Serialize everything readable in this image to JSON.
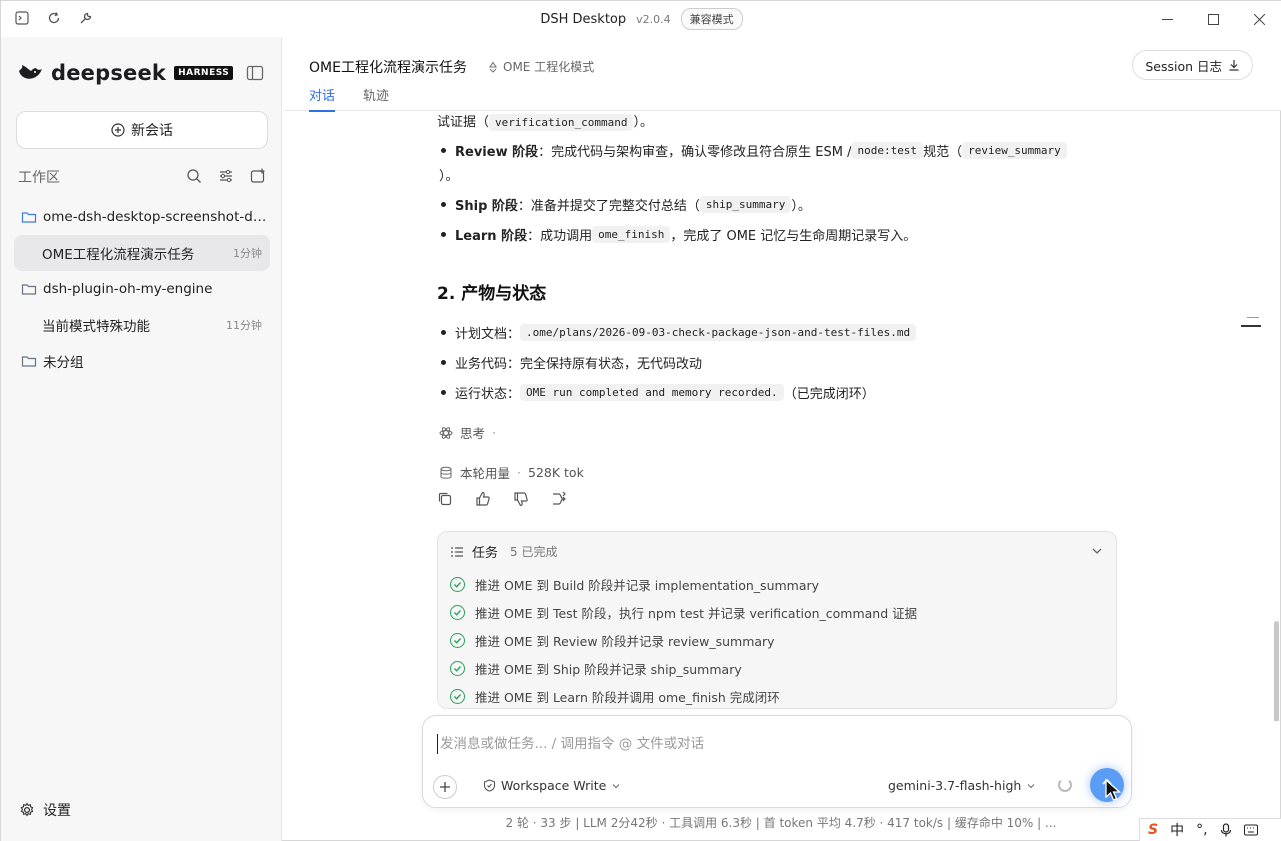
{
  "titlebar": {
    "title": "DSH Desktop",
    "version": "v2.0.4",
    "badge": "兼容模式"
  },
  "sidebar": {
    "brand_name": "deepseek",
    "brand_tag": "HARNESS",
    "new_chat": "新会话",
    "workspace_label": "工作区",
    "tree": [
      {
        "label": "ome-dsh-desktop-screenshot-de...",
        "type": "folder",
        "active": true
      },
      {
        "label": "OME工程化流程演示任务",
        "type": "session",
        "time": "1分钟",
        "selected": true
      },
      {
        "label": "dsh-plugin-oh-my-engine",
        "type": "folder"
      },
      {
        "label": "当前模式特殊功能",
        "type": "session",
        "time": "11分钟"
      },
      {
        "label": "未分组",
        "type": "folder"
      }
    ],
    "settings": "设置"
  },
  "header": {
    "task_title": "OME工程化流程演示任务",
    "mode": "OME 工程化模式",
    "session_button": "Session 日志",
    "tabs": [
      "对话",
      "轨迹"
    ]
  },
  "content": {
    "top_line": {
      "text": "试证据（",
      "code": "verification_command",
      "tail": "）。"
    },
    "bullets1": [
      {
        "bold": "Review 阶段",
        "text": "：完成代码与架构审查，确认零修改且符合原生 ESM / ",
        "code": "node:test",
        "text2": " 规范（",
        "code2": "review_summary",
        "cont": "）。"
      },
      {
        "bold": "Ship 阶段",
        "text": "：准备并提交了完整交付总结（",
        "code": "ship_summary",
        "text2": "）。"
      },
      {
        "bold": "Learn 阶段",
        "text": "：成功调用 ",
        "code": "ome_finish",
        "text2": "，完成了 OME 记忆与生命周期记录写入。"
      }
    ],
    "section_title": "2. 产物与状态",
    "bullets2": [
      {
        "text": "计划文档：",
        "code": ".ome/plans/2026-09-03-check-package-json-and-test-files.md"
      },
      {
        "text": "业务代码：完全保持原有状态，无代码改动"
      },
      {
        "text": "运行状态：",
        "code": "OME run completed and memory recorded.",
        "text2": "（已完成闭环）"
      }
    ],
    "thinking": "思考",
    "thinking_sep": "·",
    "usage_label": "本轮用量",
    "usage_sep": "·",
    "usage_value": "528K tok"
  },
  "tasks": {
    "title": "任务",
    "count": "5 已完成",
    "items": [
      "推进 OME 到 Build 阶段并记录 implementation_summary",
      "推进 OME 到 Test 阶段，执行 npm test 并记录 verification_command 证据",
      "推进 OME 到 Review 阶段并记录 review_summary",
      "推进 OME 到 Ship 阶段并记录 ship_summary",
      "推进 OME 到 Learn 阶段并调用 ome_finish 完成闭环"
    ]
  },
  "composer": {
    "placeholder": "发消息或做任务... / 调用指令 @ 文件或对话",
    "permission": "Workspace Write",
    "model": "gemini-3.7-flash-high"
  },
  "status_bar": "2 轮 · 33 步  |  LLM 2分42秒 · 工具调用 6.3秒  |  首 token 平均 4.7秒 · 417 tok/s  |  缓存命中 10%  |  ...",
  "ime": {
    "s": "S",
    "lang": "中",
    "punct": "°,"
  },
  "colors": {
    "accent": "#2f6fe4",
    "success": "#27a35a",
    "send": "#5b9cf5"
  }
}
